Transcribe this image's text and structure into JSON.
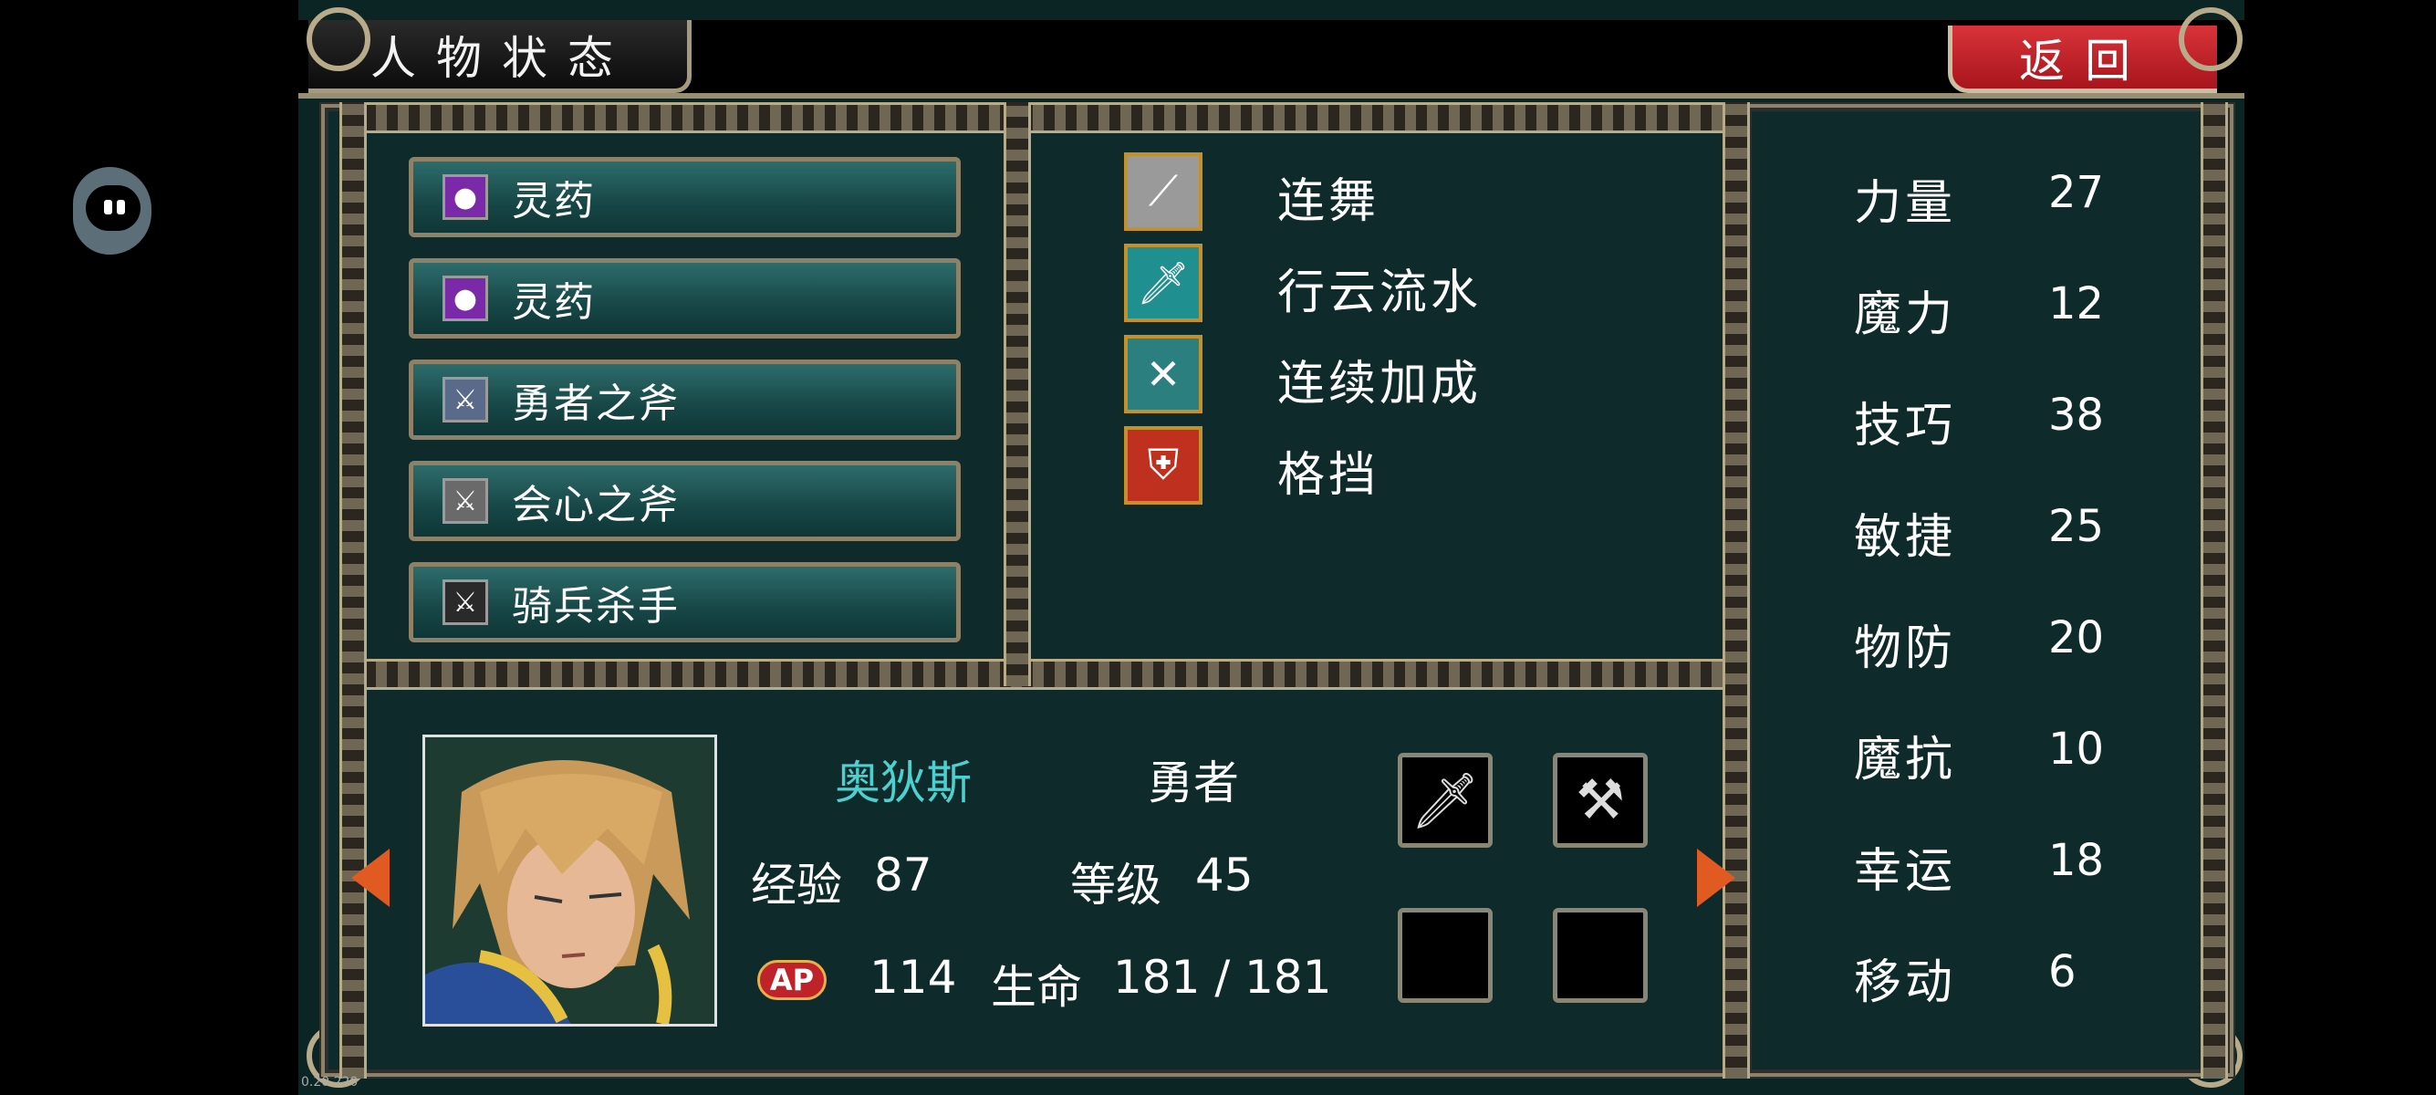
{
  "header": {
    "title": "人物状态",
    "back_label": "返回"
  },
  "items": [
    {
      "label": "灵药",
      "icon": "potion-icon"
    },
    {
      "label": "灵药",
      "icon": "potion-icon"
    },
    {
      "label": "勇者之斧",
      "icon": "axe-icon"
    },
    {
      "label": "会心之斧",
      "icon": "axe-icon"
    },
    {
      "label": "骑兵杀手",
      "icon": "axe-icon"
    }
  ],
  "skills": [
    {
      "label": "连舞",
      "icon": "slash-icon",
      "color": "#9a9a9a"
    },
    {
      "label": "行云流水",
      "icon": "sword-icon",
      "color": "#1f8f8f"
    },
    {
      "label": "连续加成",
      "icon": "crossed-swords-icon",
      "color": "#2c7f7f"
    },
    {
      "label": "格挡",
      "icon": "shield-icon",
      "color": "#c0301e"
    }
  ],
  "character": {
    "name": "奥狄斯",
    "class": "勇者",
    "exp_label": "经验",
    "exp": "87",
    "level_label": "等级",
    "level": "45",
    "ap_label": "AP",
    "ap": "114",
    "hp_label": "生命",
    "hp": "181 / 181",
    "name_color": "#4dd0d0"
  },
  "stats": [
    {
      "label": "力量",
      "value": "27"
    },
    {
      "label": "魔力",
      "value": "12"
    },
    {
      "label": "技巧",
      "value": "38"
    },
    {
      "label": "敏捷",
      "value": "25"
    },
    {
      "label": "物防",
      "value": "20"
    },
    {
      "label": "魔抗",
      "value": "10"
    },
    {
      "label": "幸运",
      "value": "18"
    },
    {
      "label": "移动",
      "value": "6"
    }
  ],
  "version": "0.20.220"
}
